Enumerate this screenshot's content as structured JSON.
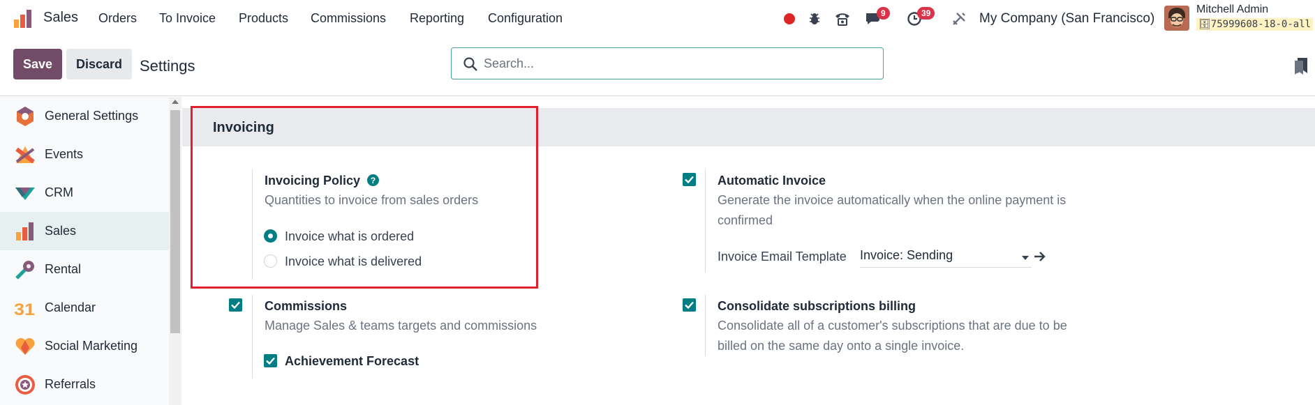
{
  "topbar": {
    "app_name": "Sales",
    "menu": [
      "Orders",
      "To Invoice",
      "Products",
      "Commissions",
      "Reporting",
      "Configuration"
    ],
    "messages_count": "9",
    "activities_count": "39",
    "company": "My Company (San Francisco)",
    "user_name": "Mitchell Admin",
    "database": "75999608-18-0-all"
  },
  "control": {
    "save_label": "Save",
    "discard_label": "Discard",
    "breadcrumb": "Settings",
    "search_placeholder": "Search..."
  },
  "sidebar": {
    "items": [
      {
        "label": "General Settings",
        "icon": "general-settings-icon"
      },
      {
        "label": "Events",
        "icon": "events-icon"
      },
      {
        "label": "CRM",
        "icon": "crm-icon"
      },
      {
        "label": "Sales",
        "icon": "sales-icon",
        "active": true
      },
      {
        "label": "Rental",
        "icon": "rental-icon"
      },
      {
        "label": "Calendar",
        "icon": "calendar-icon"
      },
      {
        "label": "Social Marketing",
        "icon": "social-marketing-icon"
      },
      {
        "label": "Referrals",
        "icon": "referrals-icon"
      }
    ]
  },
  "calendar_icon_text": "31",
  "invoicing": {
    "section_title": "Invoicing",
    "policy": {
      "title": "Invoicing Policy",
      "description": "Quantities to invoice from sales orders",
      "options": [
        "Invoice what is ordered",
        "Invoice what is delivered"
      ],
      "selected": "Invoice what is ordered"
    },
    "automatic_invoice": {
      "title": "Automatic Invoice",
      "checked": true,
      "description_line1": "Generate the invoice automatically when the online payment is",
      "description_line2": "confirmed",
      "template_label": "Invoice Email Template",
      "template_value": "Invoice: Sending"
    },
    "commissions": {
      "title": "Commissions",
      "checked": true,
      "description": "Manage Sales & teams targets and commissions",
      "sub_option": "Achievement Forecast",
      "sub_checked": true
    },
    "consolidate": {
      "title": "Consolidate subscriptions billing",
      "checked": true,
      "description_line1": "Consolidate all of a customer's subscriptions that are due to be",
      "description_line2": "billed on the same day onto a single invoice."
    }
  },
  "colors": {
    "brand": "#714b67",
    "accent": "#017e84",
    "badge": "#d9334a",
    "highlight_box": "#e2202b"
  }
}
